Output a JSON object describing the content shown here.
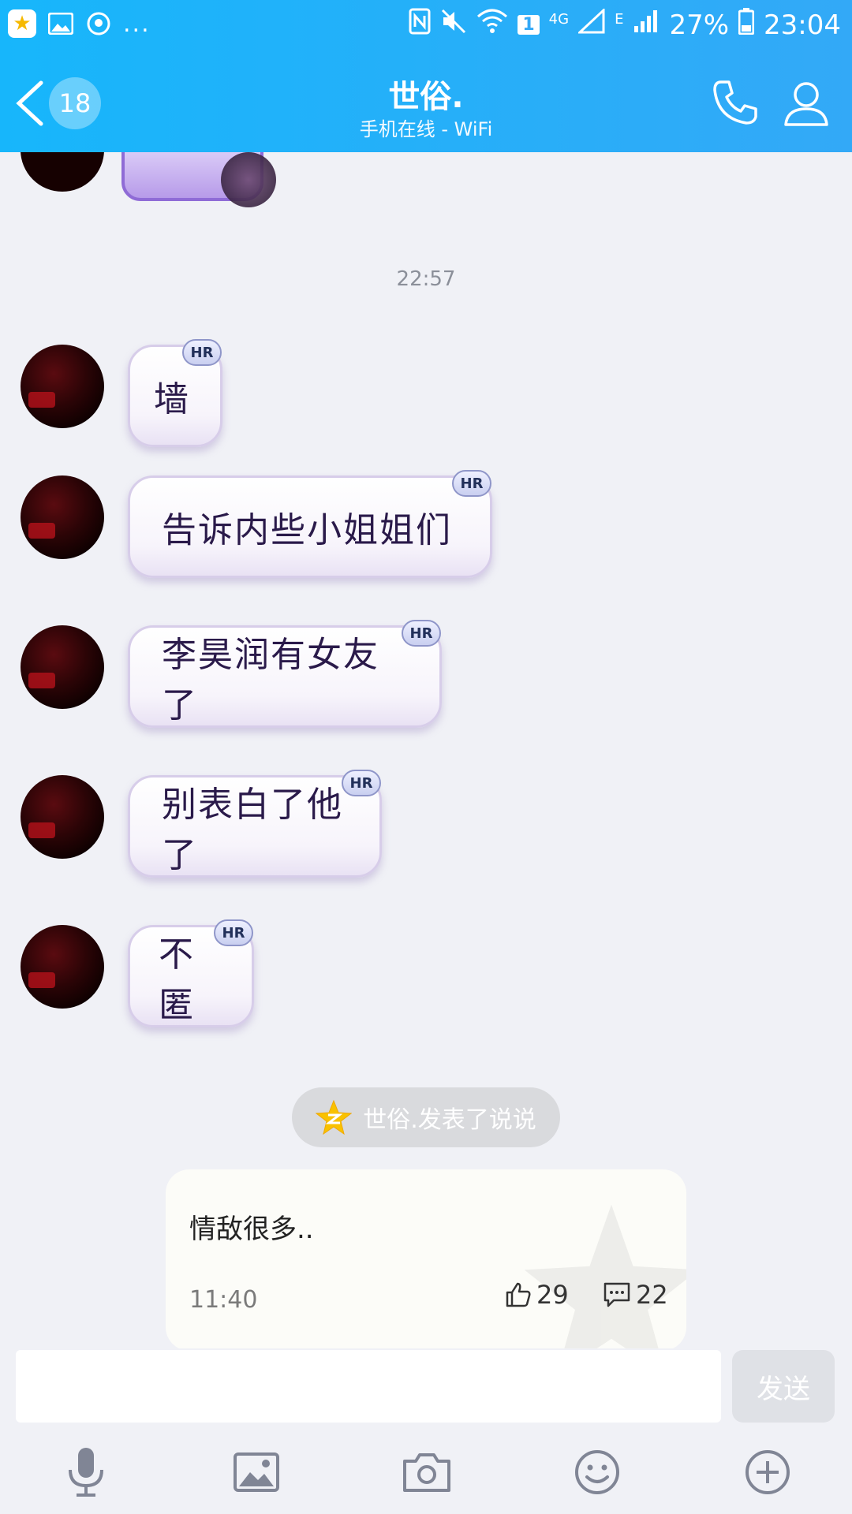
{
  "status_bar": {
    "more": "...",
    "sim_label": "1",
    "net1": "4G",
    "net2": "E",
    "battery": "27%",
    "time": "23:04"
  },
  "header": {
    "back_count": "18",
    "title": "世俗.",
    "subtitle": "手机在线 - WiFi"
  },
  "chat": {
    "timestamp": "22:57",
    "messages": [
      {
        "text": "墙",
        "tag": "HR"
      },
      {
        "text": "告诉内些小姐姐们",
        "tag": "HR"
      },
      {
        "text": "李昊润有女友了",
        "tag": "HR"
      },
      {
        "text": "别表白了他了",
        "tag": "HR"
      },
      {
        "text": "不匿",
        "tag": "HR"
      }
    ],
    "notice": "世俗.发表了说说",
    "feed": {
      "content": "情敌很多..",
      "time": "11:40",
      "likes": "29",
      "comments": "22"
    }
  },
  "input": {
    "value": "",
    "send_label": "发送"
  },
  "colors": {
    "header_start": "#17b6fb",
    "header_end": "#33a9f7",
    "background": "#f0f1f6"
  }
}
